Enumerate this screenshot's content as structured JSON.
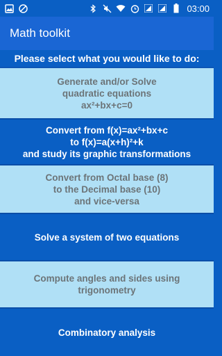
{
  "status_bar": {
    "time": "03:00",
    "icons": [
      "image-icon",
      "no-entry-icon",
      "bluetooth-icon",
      "mute-icon",
      "wifi-icon",
      "alarm-icon",
      "signal-1-icon",
      "signal-2-icon",
      "battery-icon"
    ]
  },
  "app_bar": {
    "title": "Math toolkit"
  },
  "prompt": "Please select what you would like to do:",
  "menu": [
    {
      "lines": [
        "Generate and/or Solve",
        "quadratic equations",
        "ax²+bx+c=0"
      ]
    },
    {
      "lines": [
        "Convert from f(x)=ax²+bx+c",
        "to f(x)=a(x+h)²+k",
        "and study its graphic transformations"
      ]
    },
    {
      "lines": [
        "Convert from Octal base (8)",
        "to the Decimal base (10)",
        "and vice-versa"
      ]
    },
    {
      "lines": [
        "Solve a system of two equations"
      ]
    },
    {
      "lines": [
        "Compute angles and sides using",
        "trigonometry"
      ]
    },
    {
      "lines": [
        "Combinatory analysis"
      ]
    }
  ],
  "colors": {
    "primary_dark": "#0a5fc4",
    "primary": "#1a66d4",
    "light_button": "#b0e0f6",
    "light_text": "#6c7478"
  }
}
